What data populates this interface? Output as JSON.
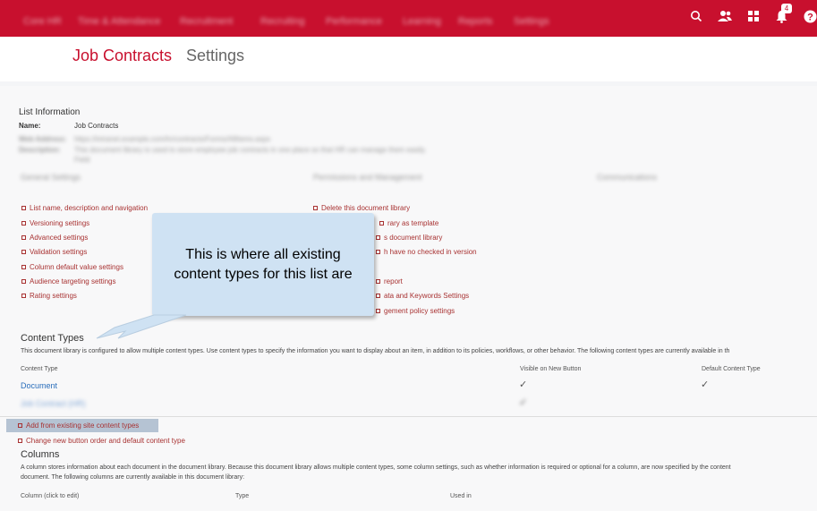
{
  "topbar": {
    "nav": [
      "Core HR",
      "Time & Attendance",
      "Recruitment",
      "Recruiting",
      "Performance",
      "Learning",
      "Reports",
      "Settings"
    ],
    "notification_count": "4",
    "icons": [
      "search-icon",
      "people-icon",
      "apps-icon",
      "bell-icon",
      "help-icon"
    ]
  },
  "header": {
    "title": "Job Contracts",
    "subtitle": "Settings"
  },
  "list_info": {
    "heading": "List Information",
    "name_label": "Name:",
    "name_value": "Job Contracts",
    "web_address_label": "Web Address:",
    "web_address_value": "https://intranet.example.com/hr/contracts/Forms/AllItems.aspx",
    "description_label": "Description:",
    "description_value": "This document library is used to store employee job contracts in one place so that HR can manage them easily.",
    "description_value2": "Field"
  },
  "columns_headings": [
    "General Settings",
    "Permissions and Management",
    "Communications"
  ],
  "general_links": [
    "List name, description and navigation",
    "Versioning settings",
    "Advanced settings",
    "Validation settings",
    "Column default value settings",
    "Audience targeting settings",
    "Rating settings"
  ],
  "perm_links": [
    "Delete this document library",
    "rary as template",
    "s document library",
    "h have no checked in version",
    "",
    "report",
    "ata and Keywords Settings",
    "gement policy settings"
  ],
  "callout": {
    "text": "This is where all existing content types for this list are"
  },
  "content_types": {
    "heading": "Content Types",
    "description": "This document library is configured to allow multiple content types. Use content types to specify the information you want to display about an item, in addition to its policies, workflows, or other behavior. The following content types are currently available in th",
    "col_type": "Content Type",
    "col_visible": "Visible on New Button",
    "col_default": "Default Content Type",
    "rows": [
      {
        "name": "Document",
        "visible": "✓",
        "default": "✓"
      },
      {
        "name": "Job Contract (HR)",
        "visible": "✓",
        "default": ""
      }
    ],
    "add_link": "Add from existing site content types",
    "change_link": "Change new button order and default content type"
  },
  "columns": {
    "heading": "Columns",
    "desc1": "A column stores information about each document in the document library. Because this document library allows multiple content types, some column settings, such as whether information is required or optional for a column, are now specified by the content",
    "desc2": "document. The following columns are currently available in this document library:",
    "col_name": "Column (click to edit)",
    "col_type": "Type",
    "col_used": "Used in"
  }
}
